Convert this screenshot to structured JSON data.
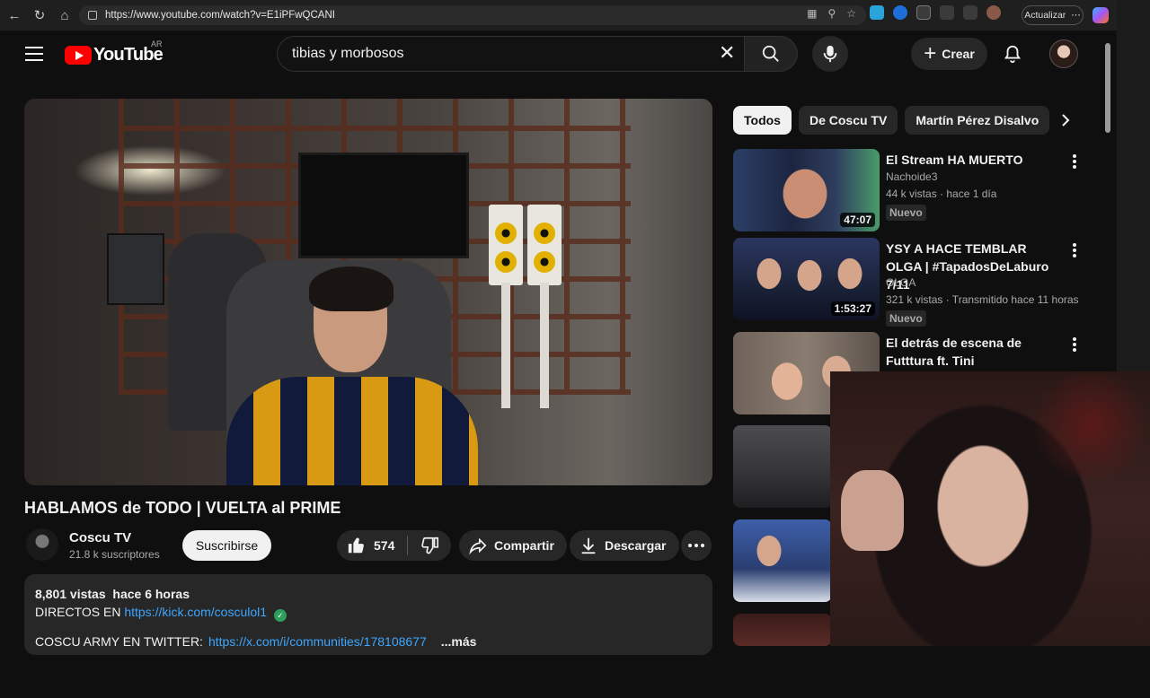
{
  "browser": {
    "url": "https://www.youtube.com/watch?v=E1iPFwQCANI",
    "update_label": "Actualizar"
  },
  "header": {
    "logo_text": "YouTube",
    "country_code": "AR",
    "search_value": "tibias y morbosos",
    "create_label": "Crear"
  },
  "video": {
    "title": "HABLAMOS de TODO | VUELTA al PRIME",
    "channel_name": "Coscu TV",
    "subscribers": "21.8 k suscriptores",
    "subscribe_label": "Suscribirse",
    "likes": "574",
    "share_label": "Compartir",
    "download_label": "Descargar"
  },
  "description": {
    "views": "8,801 vistas",
    "time": "hace 6 horas",
    "line2_prefix": "DIRECTOS EN",
    "kick_link": "https://kick.com/cosculol1",
    "line3_prefix": "COSCU ARMY EN TWITTER:",
    "twitter_link": "https://x.com/i/communities/178108677",
    "more_label": "...más"
  },
  "chips": [
    "Todos",
    "De Coscu TV",
    "Martín Pérez Disalvo"
  ],
  "recommendations": [
    {
      "title": "El Stream HA MUERTO",
      "channel": "Nachoide3",
      "stats": "44 k vistas · hace 1 día",
      "duration": "47:07",
      "badge": "Nuevo"
    },
    {
      "title": "YSY A HACE TEMBLAR OLGA | #TapadosDeLaburo 7/11",
      "channel": "OLGA",
      "stats": "321 k vistas · Transmitido hace 11 horas",
      "duration": "1:53:27",
      "badge": "Nuevo"
    },
    {
      "title": "El detrás de escena de Futttura ft. Tini"
    }
  ],
  "colors": {
    "background": "#0f0f0f",
    "youtube_red": "#ff0000",
    "link_blue": "#3ea6ff",
    "pill_bg": "#272727"
  }
}
